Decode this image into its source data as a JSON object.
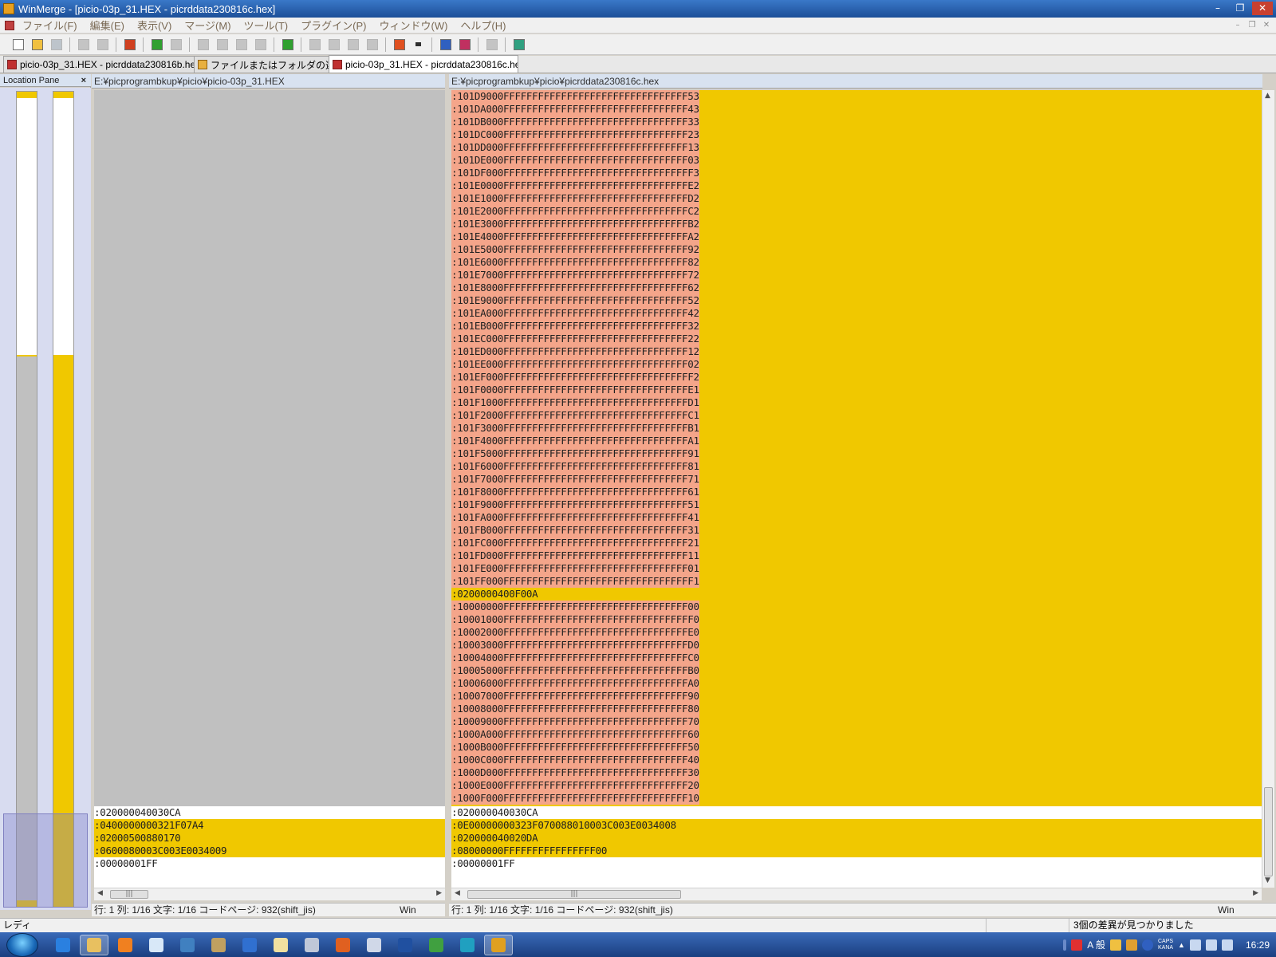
{
  "window": {
    "title": "WinMerge - [picio-03p_31.HEX - picrddata230816c.hex]",
    "minimize": "–",
    "maximize": "❐",
    "close": "✕"
  },
  "menu": {
    "items": [
      "ファイル(F)",
      "編集(E)",
      "表示(V)",
      "マージ(M)",
      "ツール(T)",
      "プラグイン(P)",
      "ウィンドウ(W)",
      "ヘルプ(H)"
    ],
    "mdi_minimize": "–",
    "mdi_restore": "❐",
    "mdi_close": "✕"
  },
  "toolbar": {
    "buttons": [
      {
        "name": "new-icon",
        "color": "#ffffff",
        "disabled": false
      },
      {
        "name": "open-icon",
        "color": "#f0c040",
        "disabled": false
      },
      {
        "name": "save-icon",
        "color": "#8090a0",
        "disabled": true
      },
      {
        "name": "undo-icon",
        "color": "#909090",
        "disabled": true
      },
      {
        "name": "redo-icon",
        "color": "#909090",
        "disabled": true
      },
      {
        "name": "options-icon",
        "color": "#d04020",
        "disabled": false
      },
      {
        "name": "next-diff-icon",
        "color": "#30a030",
        "disabled": false
      },
      {
        "name": "prev-diff-icon",
        "color": "#909090",
        "disabled": true
      },
      {
        "name": "first-diff-icon",
        "color": "#909090",
        "disabled": true
      },
      {
        "name": "current-diff-icon",
        "color": "#909090",
        "disabled": true
      },
      {
        "name": "last-diff-icon",
        "color": "#909090",
        "disabled": true
      },
      {
        "name": "all-diffs-icon",
        "color": "#909090",
        "disabled": true
      },
      {
        "name": "next-conflict-icon",
        "color": "#30a030",
        "disabled": false
      },
      {
        "name": "copy-right-icon",
        "color": "#909090",
        "disabled": true
      },
      {
        "name": "copy-left-icon",
        "color": "#909090",
        "disabled": true
      },
      {
        "name": "copy-right-advance-icon",
        "color": "#909090",
        "disabled": true
      },
      {
        "name": "copy-left-advance-icon",
        "color": "#909090",
        "disabled": true
      },
      {
        "name": "edit-icon",
        "color": "#e05020",
        "disabled": false
      },
      {
        "name": "dropdown-arrow-icon",
        "color": "#303030",
        "disabled": false
      },
      {
        "name": "compare-icon",
        "color": "#3060c0",
        "disabled": false
      },
      {
        "name": "compare-alt-icon",
        "color": "#c03060",
        "disabled": false
      },
      {
        "name": "grid-icon",
        "color": "#909090",
        "disabled": true
      },
      {
        "name": "refresh-icon",
        "color": "#30a080",
        "disabled": false
      }
    ]
  },
  "tabs": [
    {
      "label": "picio-03p_31.HEX - picrddata230816b.hex",
      "icon": "document-icon",
      "active": false
    },
    {
      "label": "ファイルまたはフォルダの選択...",
      "icon": "folder-icon",
      "active": false
    },
    {
      "label": "picio-03p_31.HEX - picrddata230816c.hex",
      "icon": "document-icon",
      "active": true
    }
  ],
  "location_pane": {
    "title": "Location Pane",
    "close": "×"
  },
  "left_pane": {
    "path": "E:¥picprogrambkup¥picio¥picio-03p_31.HEX",
    "lines": [
      {
        "text": ":020000040030CA",
        "style": "w"
      },
      {
        "text": ":0400000000321F07A4",
        "style": "y"
      },
      {
        "text": ":02000500880170",
        "style": "y"
      },
      {
        "text": ":0600080003C003E0034009",
        "style": "y"
      },
      {
        "text": ":00000001FF",
        "style": "w"
      }
    ],
    "status": "行: 1  列: 1/16  文字: 1/16  コードページ: 932(shift_jis)",
    "eol": "Win"
  },
  "right_pane": {
    "path": "E:¥picprogrambkup¥picio¥picrddata230816c.hex",
    "top_lines": [
      ":101D9000FFFFFFFFFFFFFFFFFFFFFFFFFFFFFFFF53",
      ":101DA000FFFFFFFFFFFFFFFFFFFFFFFFFFFFFFFF43",
      ":101DB000FFFFFFFFFFFFFFFFFFFFFFFFFFFFFFFF33",
      ":101DC000FFFFFFFFFFFFFFFFFFFFFFFFFFFFFFFF23",
      ":101DD000FFFFFFFFFFFFFFFFFFFFFFFFFFFFFFFF13",
      ":101DE000FFFFFFFFFFFFFFFFFFFFFFFFFFFFFFFF03",
      ":101DF000FFFFFFFFFFFFFFFFFFFFFFFFFFFFFFFFF3",
      ":101E0000FFFFFFFFFFFFFFFFFFFFFFFFFFFFFFFFE2",
      ":101E1000FFFFFFFFFFFFFFFFFFFFFFFFFFFFFFFFD2",
      ":101E2000FFFFFFFFFFFFFFFFFFFFFFFFFFFFFFFFC2",
      ":101E3000FFFFFFFFFFFFFFFFFFFFFFFFFFFFFFFFB2",
      ":101E4000FFFFFFFFFFFFFFFFFFFFFFFFFFFFFFFFA2",
      ":101E5000FFFFFFFFFFFFFFFFFFFFFFFFFFFFFFFF92",
      ":101E6000FFFFFFFFFFFFFFFFFFFFFFFFFFFFFFFF82",
      ":101E7000FFFFFFFFFFFFFFFFFFFFFFFFFFFFFFFF72",
      ":101E8000FFFFFFFFFFFFFFFFFFFFFFFFFFFFFFFF62",
      ":101E9000FFFFFFFFFFFFFFFFFFFFFFFFFFFFFFFF52",
      ":101EA000FFFFFFFFFFFFFFFFFFFFFFFFFFFFFFFF42",
      ":101EB000FFFFFFFFFFFFFFFFFFFFFFFFFFFFFFFF32",
      ":101EC000FFFFFFFFFFFFFFFFFFFFFFFFFFFFFFFF22",
      ":101ED000FFFFFFFFFFFFFFFFFFFFFFFFFFFFFFFF12",
      ":101EE000FFFFFFFFFFFFFFFFFFFFFFFFFFFFFFFF02",
      ":101EF000FFFFFFFFFFFFFFFFFFFFFFFFFFFFFFFFF2",
      ":101F0000FFFFFFFFFFFFFFFFFFFFFFFFFFFFFFFFE1",
      ":101F1000FFFFFFFFFFFFFFFFFFFFFFFFFFFFFFFFD1",
      ":101F2000FFFFFFFFFFFFFFFFFFFFFFFFFFFFFFFFC1",
      ":101F3000FFFFFFFFFFFFFFFFFFFFFFFFFFFFFFFFB1",
      ":101F4000FFFFFFFFFFFFFFFFFFFFFFFFFFFFFFFFA1",
      ":101F5000FFFFFFFFFFFFFFFFFFFFFFFFFFFFFFFF91",
      ":101F6000FFFFFFFFFFFFFFFFFFFFFFFFFFFFFFFF81",
      ":101F7000FFFFFFFFFFFFFFFFFFFFFFFFFFFFFFFF71",
      ":101F8000FFFFFFFFFFFFFFFFFFFFFFFFFFFFFFFF61",
      ":101F9000FFFFFFFFFFFFFFFFFFFFFFFFFFFFFFFF51",
      ":101FA000FFFFFFFFFFFFFFFFFFFFFFFFFFFFFFFF41",
      ":101FB000FFFFFFFFFFFFFFFFFFFFFFFFFFFFFFFF31",
      ":101FC000FFFFFFFFFFFFFFFFFFFFFFFFFFFFFFFF21",
      ":101FD000FFFFFFFFFFFFFFFFFFFFFFFFFFFFFFFF11",
      ":101FE000FFFFFFFFFFFFFFFFFFFFFFFFFFFFFFFF01",
      ":101FF000FFFFFFFFFFFFFFFFFFFFFFFFFFFFFFFFF1",
      ":0200000400F00A",
      ":10000000FFFFFFFFFFFFFFFFFFFFFFFFFFFFFFFF00",
      ":10001000FFFFFFFFFFFFFFFFFFFFFFFFFFFFFFFFF0",
      ":10002000FFFFFFFFFFFFFFFFFFFFFFFFFFFFFFFFE0",
      ":10003000FFFFFFFFFFFFFFFFFFFFFFFFFFFFFFFFD0",
      ":10004000FFFFFFFFFFFFFFFFFFFFFFFFFFFFFFFFC0",
      ":10005000FFFFFFFFFFFFFFFFFFFFFFFFFFFFFFFFB0",
      ":10006000FFFFFFFFFFFFFFFFFFFFFFFFFFFFFFFFA0",
      ":10007000FFFFFFFFFFFFFFFFFFFFFFFFFFFFFFFF90",
      ":10008000FFFFFFFFFFFFFFFFFFFFFFFFFFFFFFFF80",
      ":10009000FFFFFFFFFFFFFFFFFFFFFFFFFFFFFFFF70",
      ":1000A000FFFFFFFFFFFFFFFFFFFFFFFFFFFFFFFF60",
      ":1000B000FFFFFFFFFFFFFFFFFFFFFFFFFFFFFFFF50",
      ":1000C000FFFFFFFFFFFFFFFFFFFFFFFFFFFFFFFF40",
      ":1000D000FFFFFFFFFFFFFFFFFFFFFFFFFFFFFFFF30",
      ":1000E000FFFFFFFFFFFFFFFFFFFFFFFFFFFFFFFF20",
      ":1000F000FFFFFFFFFFFFFFFFFFFFFFFFFFFFFFFF10"
    ],
    "bottom_lines": [
      {
        "text": ":020000040030CA",
        "style": "w"
      },
      {
        "text": ":0E00000000323F070088010003C003E0034008",
        "style": "y"
      },
      {
        "text": ":020000040020DA",
        "style": "y"
      },
      {
        "text": ":08000000FFFFFFFFFFFFFFFF00",
        "style": "y"
      },
      {
        "text": ":00000001FF",
        "style": "w"
      }
    ],
    "status": "行: 1  列: 1/16  文字: 1/16  コードページ: 932(shift_jis)",
    "eol": "Win"
  },
  "colors": {
    "diff_yellow": "#f0c800",
    "diff_red": "#f4a58a",
    "gap_gray": "#c0c0c0"
  },
  "statusbar": {
    "ready": "レディ",
    "diff_count": "3個の差異が見つかりました"
  },
  "taskbar": {
    "apps": [
      {
        "name": "ie-icon",
        "color": "#2a80e0",
        "active": false
      },
      {
        "name": "explorer-icon",
        "color": "#e8c060",
        "active": true
      },
      {
        "name": "media-player-icon",
        "color": "#f08020",
        "active": false
      },
      {
        "name": "notepad-icon",
        "color": "#d8e8f8",
        "active": false
      },
      {
        "name": "screen-icon",
        "color": "#4080c0",
        "active": false
      },
      {
        "name": "paint-icon",
        "color": "#c0a060",
        "active": false
      },
      {
        "name": "network-icon",
        "color": "#3070d0",
        "active": false
      },
      {
        "name": "editor-icon",
        "color": "#f0e0a0",
        "active": false
      },
      {
        "name": "calculator-icon",
        "color": "#c0c8d8",
        "active": false
      },
      {
        "name": "firefox-icon",
        "color": "#e06020",
        "active": false
      },
      {
        "name": "document-app-icon",
        "color": "#d0d8e8",
        "active": false
      },
      {
        "name": "word-icon",
        "color": "#2050a0",
        "active": false
      },
      {
        "name": "chrome-icon",
        "color": "#40a040",
        "active": false
      },
      {
        "name": "edge-icon",
        "color": "#20a0c0",
        "active": false
      },
      {
        "name": "winmerge-icon",
        "color": "#e0a020",
        "active": true
      }
    ],
    "tray_ime": "A 般",
    "caps": "CAPS",
    "kana": "KANA",
    "clock": "16:29"
  }
}
